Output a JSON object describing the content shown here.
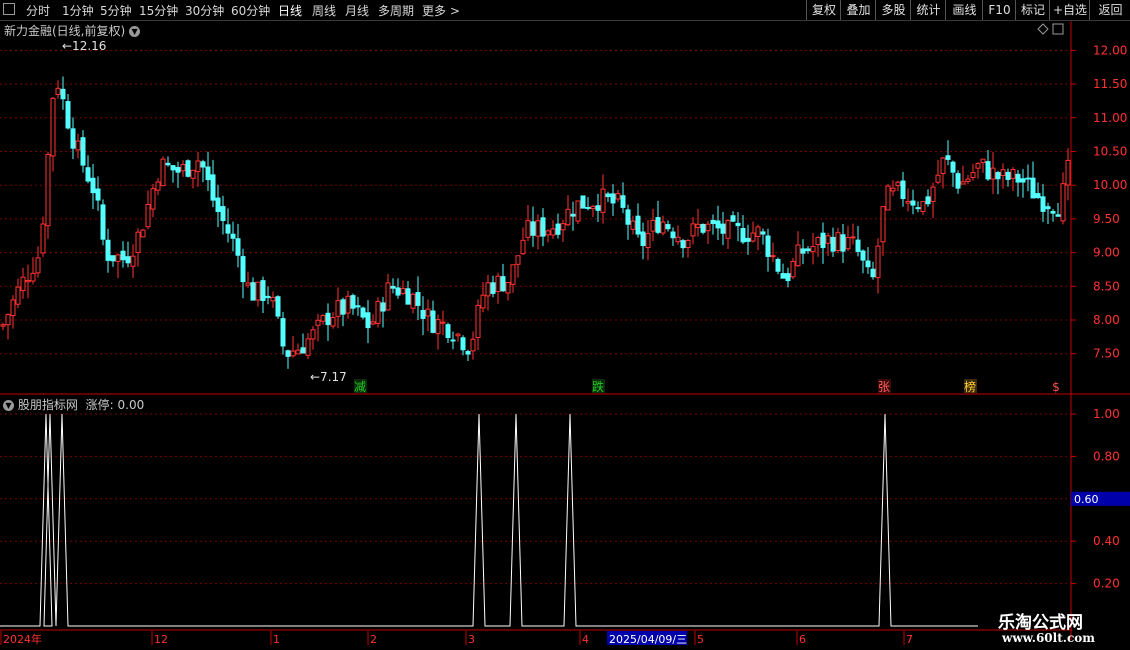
{
  "toolbar": {
    "periods": [
      "分时",
      "1分钟",
      "5分钟",
      "15分钟",
      "30分钟",
      "60分钟",
      "日线",
      "周线",
      "月线",
      "多周期",
      "更多 >"
    ],
    "active_period": "日线",
    "buttons": [
      "复权",
      "叠加",
      "多股",
      "统计",
      "画线",
      "F10",
      "标记",
      "+自选",
      "返回"
    ]
  },
  "main_panel": {
    "title": "新力金融(日线,前复权)",
    "high_label": "12.16",
    "low_label": "7.17",
    "price_ticks": [
      "12.00",
      "11.50",
      "11.00",
      "10.50",
      "10.00",
      "9.50",
      "9.00",
      "8.50",
      "8.00",
      "7.50"
    ],
    "markers": [
      {
        "text": "减",
        "color": "#22cc22",
        "bg": "#0a2a0a"
      },
      {
        "text": "跌",
        "color": "#22cc22",
        "bg": "#0a2a0a"
      },
      {
        "text": "张",
        "color": "#ff6060",
        "bg": "#3a0a0a"
      },
      {
        "text": "榜",
        "color": "#ffcc33",
        "bg": "#3a2a0a"
      },
      {
        "text": "$",
        "color": "#ff5050",
        "bg": "#000"
      }
    ]
  },
  "indicator_panel": {
    "name": "股朋指标网",
    "series_label": "涨停: 0.00",
    "ticks": [
      "1.00",
      "0.80",
      "0.60",
      "0.40",
      "0.20"
    ],
    "cursor_value": "0.60",
    "spikes": 8
  },
  "time_axis": {
    "labels": [
      "2024年",
      "12",
      "1",
      "2",
      "3",
      "4",
      "5",
      "6",
      "7"
    ],
    "cursor_date": "2025/04/09/三"
  },
  "watermark": {
    "line1": "乐淘公式网",
    "line2": "www.60lt.com"
  },
  "colors": {
    "up": "#ff3232",
    "down": "#54ffff",
    "grid": "#7a0000",
    "axis": "#c00000",
    "indicator": "#ffffff"
  }
}
